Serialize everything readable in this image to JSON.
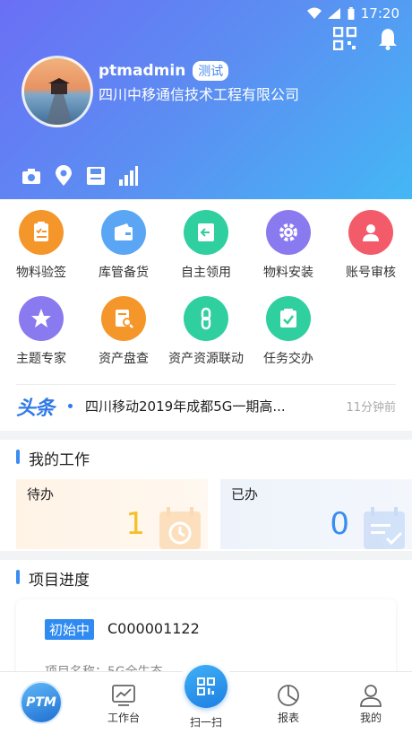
{
  "status_bar": {
    "time": "17:20"
  },
  "profile": {
    "username": "ptmadmin",
    "tag": "测试",
    "company": "四川中移通信技术工程有限公司"
  },
  "features": [
    {
      "label": "物料验签",
      "icon": "clipboard-check-icon",
      "color": "#f5962a"
    },
    {
      "label": "库管备货",
      "icon": "wallet-icon",
      "color": "#5aa6f4"
    },
    {
      "label": "自主领用",
      "icon": "door-exit-icon",
      "color": "#2fcf9f"
    },
    {
      "label": "物料安装",
      "icon": "gear-wrench-icon",
      "color": "#8a7af0"
    },
    {
      "label": "账号审核",
      "icon": "user-icon",
      "color": "#f35a6a"
    },
    {
      "label": "主题专家",
      "icon": "star-icon",
      "color": "#8a7af0"
    },
    {
      "label": "资产盘查",
      "icon": "doc-search-icon",
      "color": "#f5962a"
    },
    {
      "label": "资产资源联动",
      "icon": "link-icon",
      "color": "#2fcf9f"
    },
    {
      "label": "任务交办",
      "icon": "task-check-icon",
      "color": "#2fcf9f"
    }
  ],
  "news": {
    "source": "头条",
    "title": "四川移动2019年成都5G一期高...",
    "time": "11分钟前"
  },
  "my_work": {
    "title": "我的工作",
    "todo": {
      "label": "待办",
      "count": "1",
      "color": "#f5c02a"
    },
    "done": {
      "label": "已办",
      "count": "0",
      "color": "#3b8cf2"
    }
  },
  "project": {
    "title": "项目进度",
    "status": "初始中",
    "code": "C000001122",
    "name_partial": "项目名称：5G全生态"
  },
  "tabbar": {
    "logo": "PTM",
    "workbench": "工作台",
    "scan": "扫一扫",
    "reports": "报表",
    "mine": "我的"
  }
}
